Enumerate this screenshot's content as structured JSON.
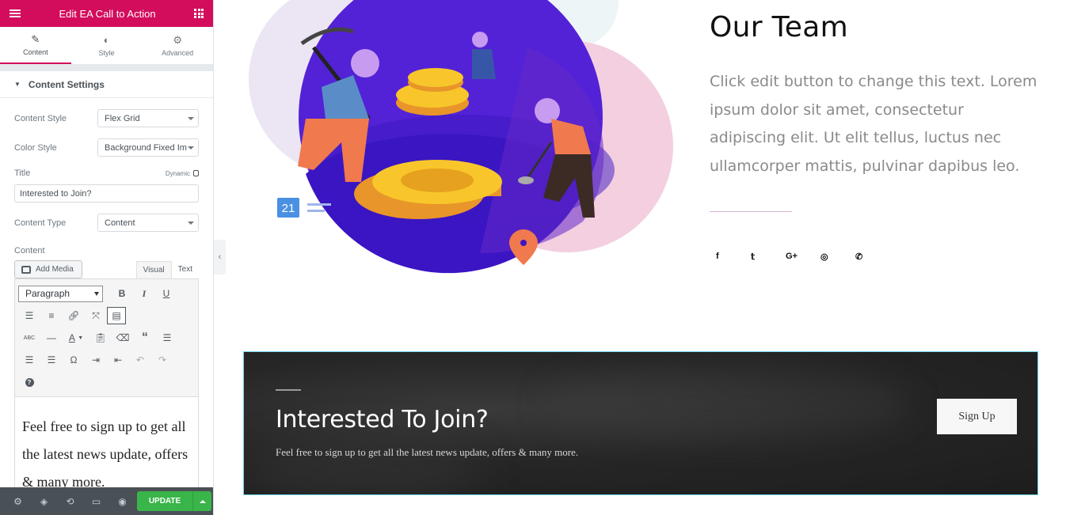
{
  "panel": {
    "header_title": "Edit EA Call to Action",
    "tabs": [
      {
        "label": "Content",
        "icon": "pencil-icon"
      },
      {
        "label": "Style",
        "icon": "contrast-icon"
      },
      {
        "label": "Advanced",
        "icon": "gear-icon"
      }
    ],
    "section_title": "Content Settings",
    "content_style": {
      "label": "Content Style",
      "value": "Flex Grid"
    },
    "color_style": {
      "label": "Color Style",
      "value": "Background Fixed Im"
    },
    "title_field": {
      "label": "Title",
      "dynamic_label": "Dynamic",
      "value": "Interested to Join?"
    },
    "content_type": {
      "label": "Content Type",
      "value": "Content"
    },
    "content_label": "Content",
    "add_media_label": "Add Media",
    "editor_tabs": {
      "visual": "Visual",
      "text": "Text"
    },
    "format_select": "Paragraph",
    "editor_text": "Feel free to sign up to get all the latest news update, offers & many more.",
    "update_label": "UPDATE",
    "accent_color": "#d30c5c",
    "update_color": "#39b54a"
  },
  "team": {
    "title": "Our Team",
    "text": "Click edit button to change this text. Lorem ipsum dolor sit amet, consectetur adipiscing elit. Ut elit tellus, luctus nec ullamcorper mattis, pulvinar dapibus leo.",
    "socials": [
      {
        "icon": "facebook-icon",
        "glyph": "f"
      },
      {
        "icon": "twitter-icon",
        "glyph": "🐦"
      },
      {
        "icon": "google-plus-icon",
        "glyph": "G+"
      },
      {
        "icon": "instagram-icon",
        "glyph": "◎"
      },
      {
        "icon": "whatsapp-icon",
        "glyph": "✆"
      }
    ]
  },
  "illustration": {
    "calendar_number": "21"
  },
  "cta": {
    "title": "Interested To Join?",
    "text": "Feel free to sign up to get all the latest news update, offers & many more.",
    "button": "Sign Up"
  }
}
